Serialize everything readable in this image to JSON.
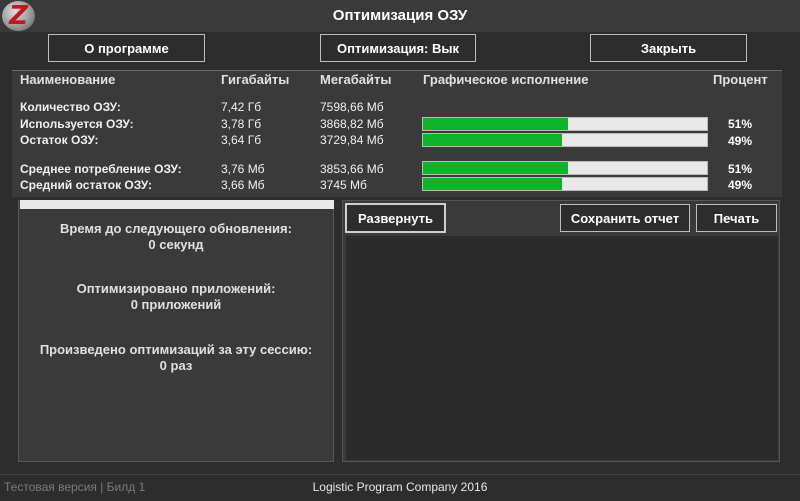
{
  "window": {
    "title": "Оптимизация ОЗУ",
    "logo_letter": "Z"
  },
  "toolbar": {
    "about": "О программе",
    "optimize": "Оптимизация: Вык",
    "close": "Закрыть"
  },
  "table": {
    "headers": [
      "Наименование",
      "Гигабайты",
      "Мегабайты",
      "Графическое исполнение",
      "Процент"
    ],
    "rows": [
      {
        "label": "Количество ОЗУ:",
        "gb": "7,42 Гб",
        "mb": "7598,66 Мб"
      },
      {
        "label": "Используется ОЗУ:",
        "gb": "3,78 Гб",
        "mb": "3868,82 Мб",
        "percent": "51%",
        "fill": 0.51
      },
      {
        "label": "Остаток ОЗУ:",
        "gb": "3,64 Гб",
        "mb": "3729,84 Мб",
        "percent": "49%",
        "fill": 0.49
      },
      {
        "label": "Среднее потребление ОЗУ:",
        "gb": "3,76 Мб",
        "mb": "3853,66 Мб",
        "percent": "51%",
        "fill": 0.51
      },
      {
        "label": "Средний остаток ОЗУ:",
        "gb": "3,66 Мб",
        "mb": "3745 Мб",
        "percent": "49%",
        "fill": 0.49
      }
    ]
  },
  "info": {
    "next_update_label": "Время до следующего обновления:",
    "next_update_value": "0 секунд",
    "optimized_apps_label": "Оптимизировано приложений:",
    "optimized_apps_value": "0 приложений",
    "session_label": "Произведено оптимизаций за эту сессию:",
    "session_value": "0 раз"
  },
  "log": {
    "expand": "Развернуть",
    "save_report": "Сохранить отчет",
    "print": "Печать"
  },
  "footer": {
    "version": "Тестовая версия | Билд 1",
    "company": "Logistic Program Company 2016"
  },
  "colors": {
    "bar_fill": "#0fb328",
    "bar_bg": "#e8e8e8",
    "background": "#2d2d2d"
  }
}
